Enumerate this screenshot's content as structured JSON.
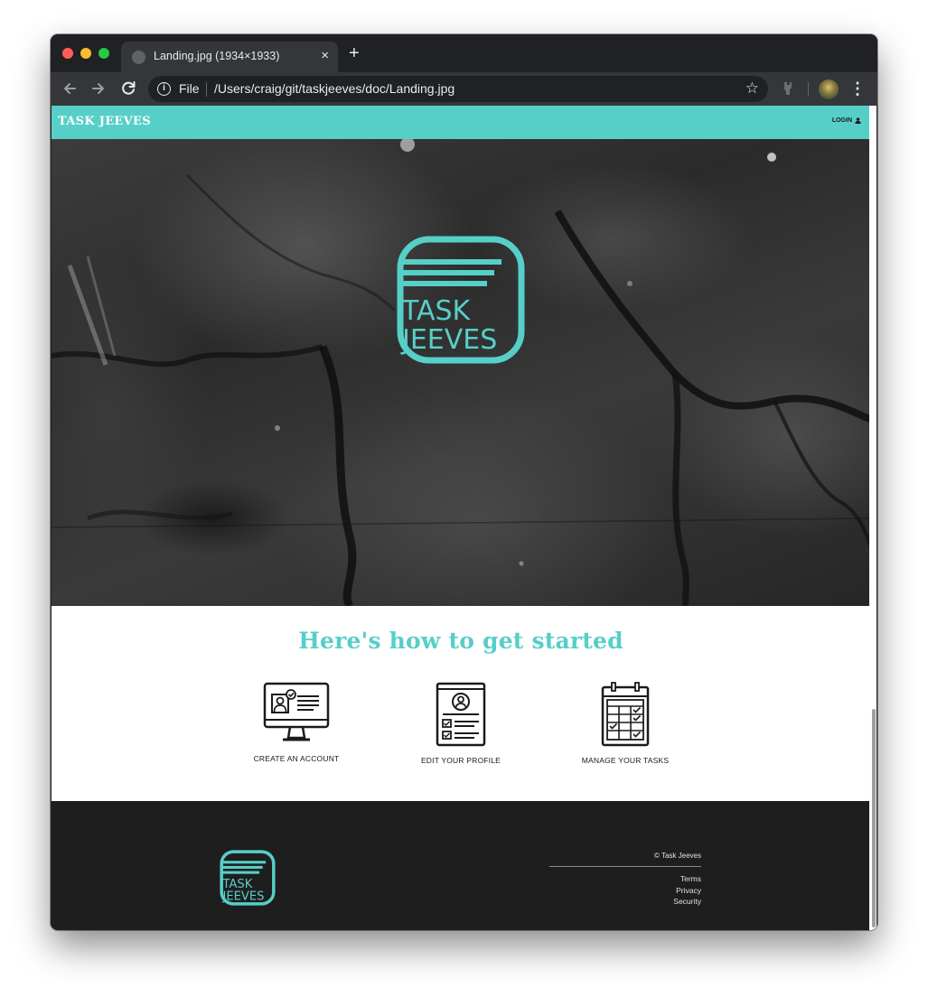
{
  "browser": {
    "tab_title": "Landing.jpg (1934×1933)",
    "close_glyph": "×",
    "new_tab_glyph": "+",
    "url_scheme_label": "File",
    "url": "/Users/craig/git/taskjeeves/doc/Landing.jpg",
    "icons": [
      "back-arrow-icon",
      "forward-arrow-icon",
      "reload-icon",
      "info-icon",
      "star-icon",
      "extension-icon",
      "profile-avatar",
      "kebab-menu-icon"
    ]
  },
  "site": {
    "brand": "TASK JEEVES",
    "login_label": "LOGIN",
    "logo_text_line1": "TASK",
    "logo_text_line2": "JEEVES",
    "accent_color": "#56cfc8",
    "steps_heading": "Here's how to get started",
    "steps": [
      {
        "label": "CREATE AN ACCOUNT",
        "icon": "monitor-profile-icon"
      },
      {
        "label": "EDIT YOUR PROFILE",
        "icon": "profile-form-icon"
      },
      {
        "label": "MANAGE YOUR TASKS",
        "icon": "calendar-checklist-icon"
      }
    ],
    "footer": {
      "copyright": "© Task Jeeves",
      "links": [
        "Terms",
        "Privacy",
        "Security"
      ]
    }
  }
}
